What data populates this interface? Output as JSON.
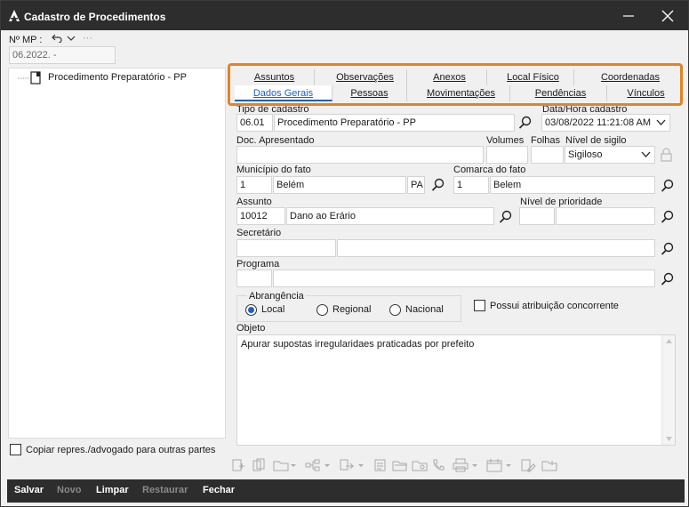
{
  "window": {
    "title": "Cadastro de Procedimentos"
  },
  "header": {
    "mp_label": "Nº MP :",
    "mp_value": "06.2022.          -"
  },
  "tree": {
    "item": "Procedimento Preparatório - PP"
  },
  "copy_checkbox_label": "Copiar repres./advogado para outras partes",
  "tabs_row1": [
    "Assuntos",
    "Observações",
    "Anexos",
    "Local Físico",
    "Coordenadas"
  ],
  "tabs_row2": [
    "Dados Gerais",
    "Pessoas",
    "Movimentações",
    "Pendências",
    "Vínculos"
  ],
  "active_tab": "Dados Gerais",
  "form": {
    "tipo_label": "Tipo de cadastro",
    "tipo_code": "06.01",
    "tipo_value": "Procedimento Preparatório - PP",
    "datahora_label": "Data/Hora cadastro",
    "datahora_value": "03/08/2022 11:21:08 AM",
    "doc_label": "Doc. Apresentado",
    "volumes_label": "Volumes",
    "folhas_label": "Folhas",
    "sigilo_label": "Nível de sigilo",
    "sigilo_value": "Sigiloso",
    "municipio_label": "Município do fato",
    "municipio_code": "1",
    "municipio_value": "Belém",
    "municipio_uf": "PA",
    "comarca_label": "Comarca do fato",
    "comarca_code": "1",
    "comarca_value": "Belem",
    "assunto_label": "Assunto",
    "assunto_code": "10012",
    "assunto_value": "Dano ao Erário",
    "prioridade_label": "Nível de prioridade",
    "secretario_label": "Secretário",
    "programa_label": "Programa",
    "abrangencia_label": "Abrangência",
    "abrangencia_options": [
      "Local",
      "Regional",
      "Nacional"
    ],
    "abrangencia_selected": "Local",
    "concorrente_label": "Possui atribuição concorrente",
    "objeto_label": "Objeto",
    "objeto_value": "Apurar supostas irregularidaes praticadas por prefeito"
  },
  "bottom_buttons": [
    {
      "label": "Salvar",
      "enabled": true
    },
    {
      "label": "Novo",
      "enabled": false
    },
    {
      "label": "Limpar",
      "enabled": true
    },
    {
      "label": "Restaurar",
      "enabled": false
    },
    {
      "label": "Fechar",
      "enabled": true
    }
  ],
  "colors": {
    "titlebar": "#2d2d2d",
    "tab_highlight": "#e8821e",
    "accent": "#1f5fbf"
  }
}
